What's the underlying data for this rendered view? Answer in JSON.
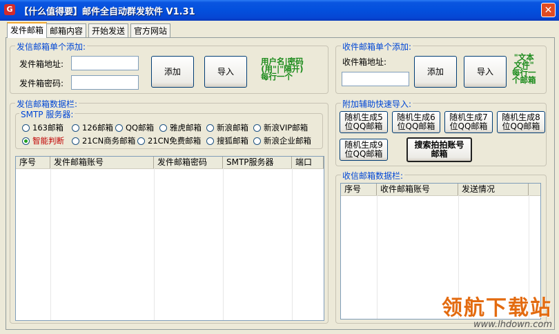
{
  "window": {
    "title": "【什么值得要】邮件全自动群发软件 V1.31",
    "app_icon_glyph": "G",
    "close_glyph": "✕"
  },
  "tabs": [
    "发件邮箱",
    "邮箱内容",
    "开始发送",
    "官方网站"
  ],
  "sender_add": {
    "legend": "发信邮箱单个添加:",
    "address_label": "发件箱地址:",
    "password_label": "发件箱密码:",
    "add_button": "添加",
    "import_button": "导入",
    "note_lines": [
      "用户名|密码",
      "(用\"|\"隔开)",
      "每行一个"
    ]
  },
  "sender_data": {
    "legend": "发信邮箱数据栏:",
    "smtp_legend": "SMTP 服务器:",
    "smtp_options_row1": [
      "163邮箱",
      "126邮箱",
      "QQ邮箱",
      "雅虎邮箱",
      "新浪邮箱",
      "新浪VIP邮箱"
    ],
    "smtp_options_row2": [
      "智能判断",
      "21CN商务邮箱",
      "21CN免费邮箱",
      "搜狐邮箱",
      "新浪企业邮箱"
    ],
    "selected_option": "智能判断",
    "columns": [
      "序号",
      "发件邮箱账号",
      "发件邮箱密码",
      "SMTP服务器",
      "端口"
    ]
  },
  "receiver_add": {
    "legend": "收件邮箱单个添加:",
    "address_label": "收件箱地址:",
    "add_button": "添加",
    "import_button": "导入",
    "note_lines": [
      "\"文本",
      "文件\"",
      "每行一",
      "个邮箱"
    ]
  },
  "quick_import": {
    "legend": "附加辅助快速导入:",
    "buttons": [
      [
        "随机生成5",
        "位QQ邮箱"
      ],
      [
        "随机生成6",
        "位QQ邮箱"
      ],
      [
        "随机生成7",
        "位QQ邮箱"
      ],
      [
        "随机生成8",
        "位QQ邮箱"
      ],
      [
        "随机生成9",
        "位QQ邮箱"
      ]
    ],
    "search_button": [
      "搜索拍拍账号",
      "邮箱"
    ]
  },
  "receiver_data": {
    "legend": "收信邮箱数据栏:",
    "columns": [
      "序号",
      "收件邮箱账号",
      "发送情况"
    ]
  },
  "watermark": {
    "main": "领航下载站",
    "url": "www.lhdown.com"
  },
  "colors": {
    "title_bar": "#0350dd",
    "legend_blue": "#0046d5",
    "note_green": "#1a8a1a",
    "selected_red": "#c00000",
    "watermark_orange": "#e36b10"
  }
}
